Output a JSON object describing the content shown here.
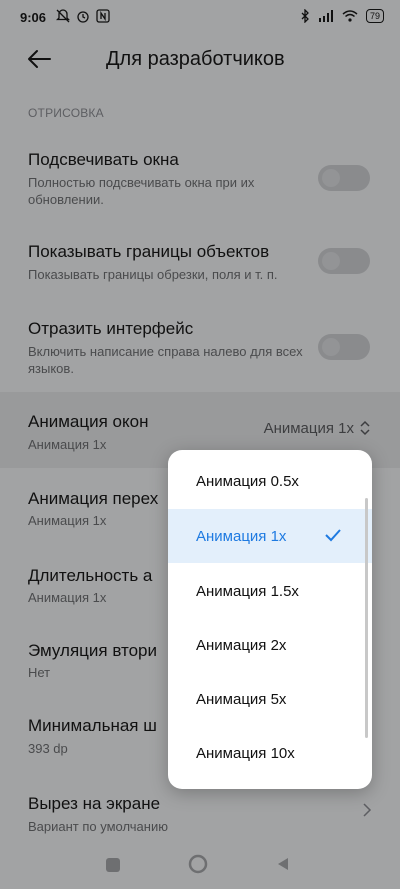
{
  "status_bar": {
    "time": "9:06",
    "battery": "79"
  },
  "header": {
    "title": "Для разработчиков"
  },
  "section": {
    "label": "ОТРИСОВКА"
  },
  "settings": [
    {
      "title": "Подсвечивать окна",
      "subtitle": "Полностью подсвечивать окна при их обновлении."
    },
    {
      "title": "Показывать границы объектов",
      "subtitle": "Показывать границы обрезки, поля и т. п."
    },
    {
      "title": "Отразить интерфейс",
      "subtitle": "Включить написание справа налево для всех языков."
    },
    {
      "title": "Анимация окон",
      "subtitle": "Анимация 1x",
      "value": "Анимация 1x"
    },
    {
      "title": "Анимация перех",
      "subtitle": "Анимация 1x"
    },
    {
      "title": "Длительность а",
      "subtitle": "Анимация 1x"
    },
    {
      "title": "Эмуляция втори",
      "subtitle": "Нет"
    },
    {
      "title": "Минимальная ш",
      "subtitle": "393 dp"
    },
    {
      "title": "Вырез на экране",
      "subtitle": "Вариант по умолчанию"
    }
  ],
  "toggles": [
    false,
    false,
    false
  ],
  "popup": {
    "options": [
      "Анимация 0.5x",
      "Анимация 1x",
      "Анимация 1.5x",
      "Анимация 2x",
      "Анимация 5x",
      "Анимация 10x"
    ],
    "selected_index": 1
  },
  "colors": {
    "accent": "#1e7ae1",
    "dim_background": "#a2a3a4"
  },
  "icons": {
    "back": "arrow-left-icon",
    "check": "check-icon",
    "updown": "chevron-up-down-icon",
    "next": "chevron-right-icon"
  }
}
